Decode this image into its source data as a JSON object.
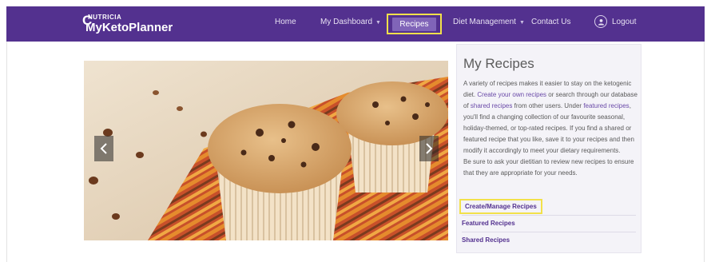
{
  "brand": {
    "company": "NUTRICIA",
    "product": "MyKetoPlanner"
  },
  "nav": {
    "home": "Home",
    "dashboard": "My Dashboard",
    "recipes": "Recipes",
    "diet": "Diet Management",
    "contact": "Contact Us",
    "logout": "Logout"
  },
  "icons": {
    "caret": "chevron-down-icon",
    "prev": "chevron-left-icon",
    "next": "chevron-right-icon",
    "user": "user-icon"
  },
  "colors": {
    "nav_bg": "#53318f",
    "active_tab": "#8064b8",
    "highlight": "#f2e14a",
    "link": "#6a4aa8"
  },
  "panel": {
    "title": "My Recipes",
    "p1_a": "A variety of recipes makes it easier to stay on the ketogenic diet. ",
    "p1_link1": "Create your own recipes",
    "p1_b": " or search through our database of ",
    "p1_link2": "shared recipes",
    "p1_c": " from other users. Under ",
    "p1_link3": "featured recipes",
    "p1_d": ", you'll find a changing collection of our favourite seasonal, holiday-themed, or top-rated recipes. If you find a shared or featured recipe that you like, save it to your recipes and then modify it accordingly to meet your dietary requirements.",
    "p2": "Be sure to ask your dietitian to review new recipes to ensure that they are appropriate for your needs.",
    "links": {
      "create": "Create/Manage Recipes",
      "featured": "Featured Recipes",
      "shared": "Shared Recipes"
    }
  }
}
